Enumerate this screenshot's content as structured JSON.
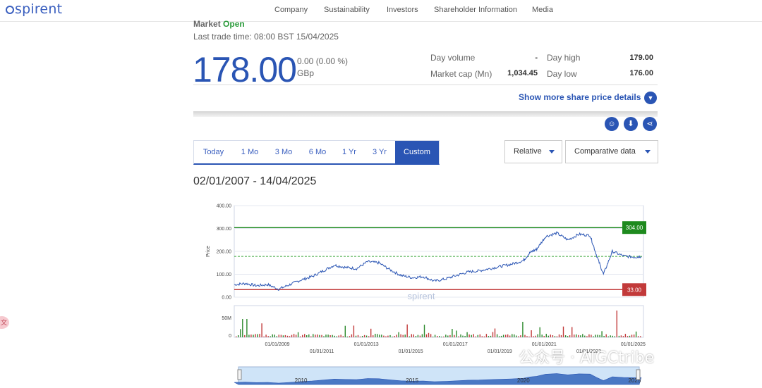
{
  "brand": {
    "logo": "spirent"
  },
  "nav": [
    {
      "label": "Company"
    },
    {
      "label": "Sustainability"
    },
    {
      "label": "Investors"
    },
    {
      "label": "Shareholder Information"
    },
    {
      "label": "Media"
    }
  ],
  "quote": {
    "market_label": "Market",
    "market_status": "Open",
    "last_trade": "Last trade time: 08:00 BST 15/04/2025",
    "price": "178.00",
    "change": "0.00 (0.00 %)",
    "currency": "GBp",
    "day_volume_label": "Day volume",
    "day_volume": "-",
    "market_cap_label": "Market cap (Mn)",
    "market_cap": "1,034.45",
    "day_high_label": "Day high",
    "day_high": "179.00",
    "day_low_label": "Day low",
    "day_low": "176.00",
    "show_more": "Show more share price details"
  },
  "icons": {
    "accessibility": "accessibility-icon",
    "download": "download-icon",
    "share": "share-icon"
  },
  "tabs": [
    {
      "label": "Today"
    },
    {
      "label": "1 Mo"
    },
    {
      "label": "3 Mo"
    },
    {
      "label": "6 Mo"
    },
    {
      "label": "1 Yr"
    },
    {
      "label": "3 Yr"
    },
    {
      "label": "Custom",
      "active": true
    }
  ],
  "controls": {
    "relative": "Relative",
    "comparative": "Comparative data"
  },
  "range_text": "02/01/2007 - 14/04/2025",
  "watermark": "公众号 · AIGCtribe",
  "chart_data": {
    "type": "line",
    "ylabel": "Price",
    "ylim": [
      0,
      400
    ],
    "yticks": [
      "400.00",
      "300.00",
      "200.00",
      "100.00",
      "0.00"
    ],
    "reference_lines": [
      {
        "label": "304.00",
        "value": 304,
        "color": "#1e8a1e"
      },
      {
        "label": "33.00",
        "value": 33,
        "color": "#c23a3a"
      }
    ],
    "current_level": 178,
    "x": [
      2007,
      2007.5,
      2008,
      2008.5,
      2009,
      2009.5,
      2010,
      2010.5,
      2011,
      2011.5,
      2012,
      2012.5,
      2013,
      2013.5,
      2014,
      2014.5,
      2015,
      2015.5,
      2016,
      2016.5,
      2017,
      2017.5,
      2018,
      2018.5,
      2019,
      2019.5,
      2020,
      2020.3,
      2020.6,
      2021,
      2021.5,
      2022,
      2022.5,
      2023,
      2023.3,
      2023.6,
      2024,
      2024.5,
      2025.0,
      2025.3
    ],
    "series": [
      {
        "values": [
          55,
          60,
          50,
          55,
          35,
          55,
          75,
          90,
          115,
          140,
          130,
          125,
          155,
          150,
          120,
          95,
          85,
          90,
          70,
          80,
          95,
          110,
          115,
          125,
          135,
          145,
          160,
          195,
          210,
          265,
          280,
          250,
          275,
          270,
          180,
          100,
          200,
          180,
          175,
          178
        ]
      }
    ],
    "volume": {
      "ylabel_ticks": [
        "50M",
        "0"
      ]
    },
    "x_ticks_top": [
      "01/01/2009",
      "01/01/2013",
      "01/01/2017",
      "01/01/2021",
      "01/01/2025"
    ],
    "x_ticks_bottom": [
      "01/01/2011",
      "01/01/2015",
      "01/01/2019",
      "01/01/2023"
    ],
    "navigator_ticks": [
      "2010",
      "2015",
      "2020",
      "2025"
    ],
    "chart_watermark": "spirent"
  }
}
